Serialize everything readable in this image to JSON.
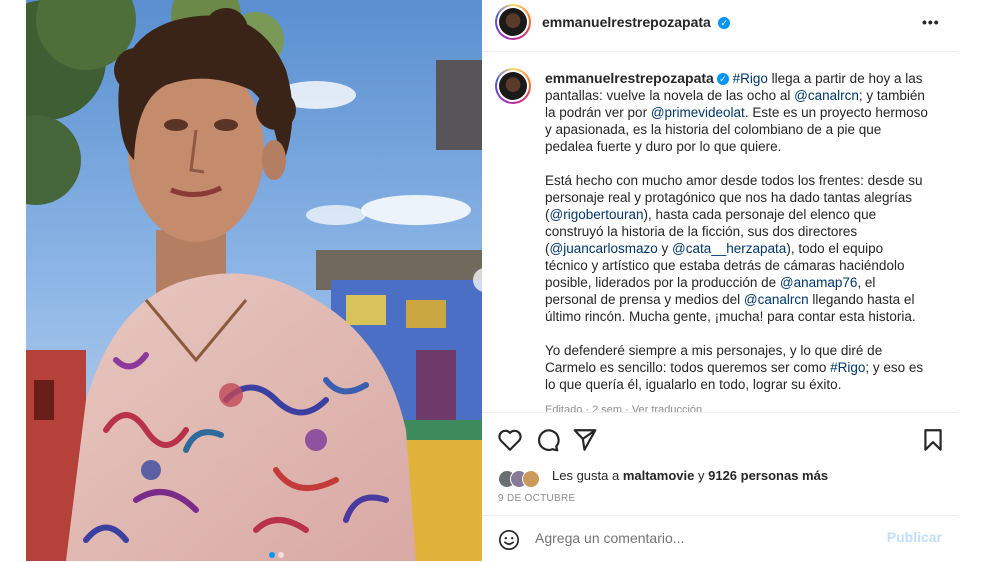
{
  "post": {
    "username": "emmanuelrestrepozapata",
    "more_label": "•••"
  },
  "caption": {
    "username": "emmanuelrestrepozapata",
    "p1": {
      "tag1": "#Rigo",
      "t1": " llega a partir de hoy a las pantallas: vuelve la novela de las ocho al ",
      "m1": "@canalrcn",
      "t2": "; y también la podrán ver por ",
      "m2": "@primevideolat",
      "t3": ". Este es un proyecto hermoso y apasionada, es la historia del colombiano de a pie que pedalea fuerte y duro por lo que quiere."
    },
    "p2": {
      "t1": "Está hecho con mucho amor desde todos los frentes: desde su personaje real y protagónico que nos ha dado tantas alegrías (",
      "m1": "@rigobertouran",
      "t2": "), hasta cada personaje del elenco que construyó la historia de la ficción, sus dos directores (",
      "m2": "@juancarlosmazo",
      "t3": " y ",
      "m3": "@cata__herzapata",
      "t4": "), todo el equipo técnico y artístico que estaba detrás de cámaras haciéndolo posible, liderados por la producción de ",
      "m4": "@anamap76",
      "t5": ", el personal de prensa y medios del ",
      "m5": "@canalrcn",
      "t6": " llegando hasta el último rincón. Mucha gente, ¡mucha! para contar esta historia."
    },
    "p3": {
      "t1": "Yo defenderé siempre a mis personajes, y lo que diré de Carmelo es sencillo: todos queremos ser como ",
      "tag1": "#Rigo",
      "t2": "; y eso es lo que quería él, igualarlo en todo, lograr su éxito."
    },
    "meta": "Editado · 2 sem · Ver traducción"
  },
  "likes": {
    "prefix": "Les gusta a ",
    "user": "maltamovie",
    "mid": " y ",
    "count": "9126 personas más"
  },
  "date": "9 DE OCTUBRE",
  "comment": {
    "placeholder": "Agrega un comentario...",
    "publish": "Publicar"
  },
  "colors": {
    "verified": "#0095f6",
    "mention": "#00376b",
    "publish_disabled": "#c0dffd"
  },
  "icons": [
    "heart-icon",
    "comment-icon",
    "share-icon",
    "bookmark-icon",
    "emoji-icon",
    "verified-icon",
    "chevron-right-icon"
  ],
  "carousel": {
    "slides": 2,
    "current": 1
  }
}
